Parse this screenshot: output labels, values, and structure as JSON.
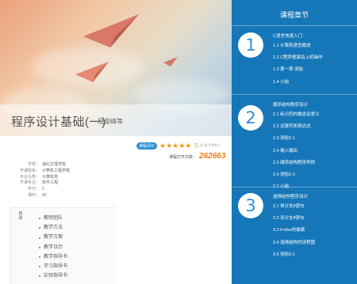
{
  "course": {
    "title": "程序设计基础(一)",
    "teacher": "屈俊峰等"
  },
  "rating": {
    "badge": "课程评价",
    "stars": "★★★★★",
    "score": "5",
    "unit": "分 (5人评价)"
  },
  "visits": {
    "label": "课程打开次数：",
    "count": "262663"
  },
  "info": [
    {
      "k": "学校：",
      "v": "湖北文理学院"
    },
    {
      "k": "开课院系：",
      "v": "计算机工程学院"
    },
    {
      "k": "专业大类：",
      "v": "计算机类"
    },
    {
      "k": "开课专业：",
      "v": "软件工程"
    },
    {
      "k": "学分：",
      "v": "2"
    },
    {
      "k": "课时：",
      "v": "42"
    }
  ],
  "toc": {
    "label": "目录",
    "items": [
      "教师团队",
      "教学方法",
      "教学方案",
      "教学日历",
      "教学指导书",
      "学习指导书",
      "实验指导书"
    ]
  },
  "panel": {
    "title": "课程章节",
    "chapters": [
      {
        "num": "1",
        "title": "C语言快速入门",
        "items": [
          "1.1  计算机语言概述",
          "1.2  C程序框架及上机操作",
          "1.3  第一章 测验",
          "1.4  小结"
        ]
      },
      {
        "num": "2",
        "title": "顺序结构程序设计",
        "items": [
          "2.1  标识符的概念及意义",
          "2.2  运算符和表达式",
          "2.3  测验2-1",
          "2.4  输入输出",
          "2.5  顺序结构程序举例",
          "2.6  测验2-2",
          "2.7  小结"
        ]
      },
      {
        "num": "3",
        "title": "选择结构程序设计",
        "items": [
          "3.1  单分支if语句",
          "3.2  双分支if语句",
          "3.3  if-else的嵌套",
          "3.4  选择结构的流程图",
          "3.5  测验3-1"
        ]
      }
    ]
  },
  "colors": {
    "panel": "#1677b8",
    "accent": "#f39c12",
    "visits": "#e67e22"
  }
}
